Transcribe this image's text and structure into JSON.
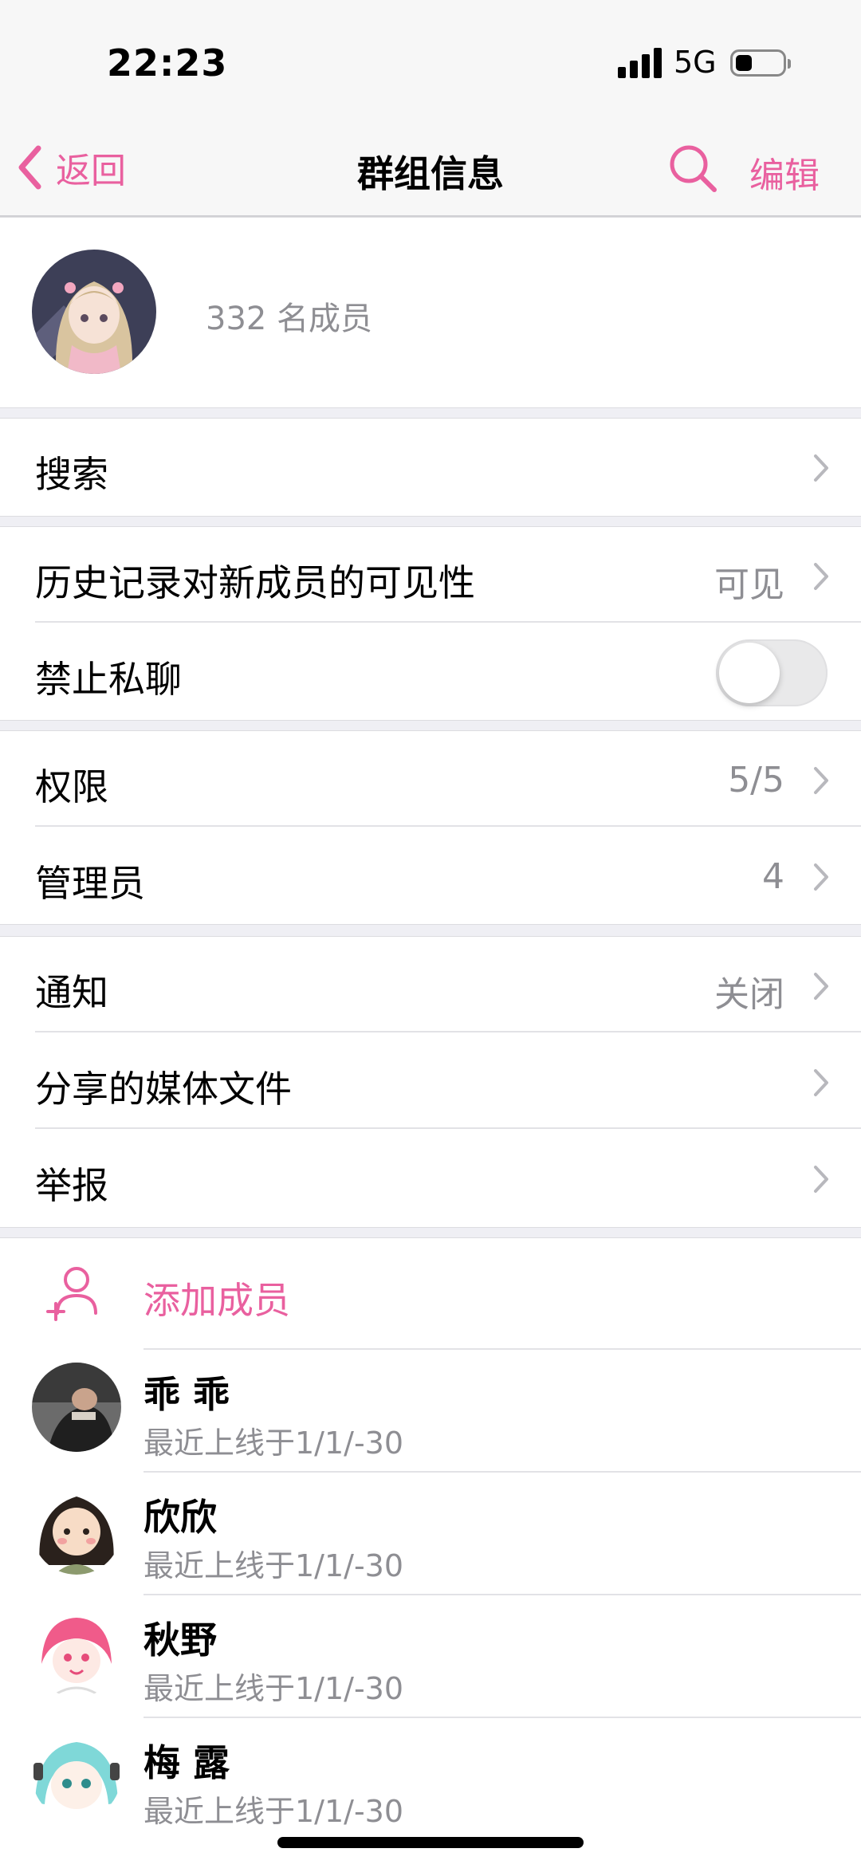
{
  "status_bar": {
    "time": "22:23",
    "network": "5G"
  },
  "nav": {
    "back_label": "返回",
    "title": "群组信息",
    "edit_label": "编辑"
  },
  "group": {
    "members_count": "332 名成员"
  },
  "rows": {
    "search": {
      "label": "搜索"
    },
    "history": {
      "label": "历史记录对新成员的可见性",
      "value": "可见"
    },
    "no_private_chat": {
      "label": "禁止私聊",
      "enabled": false
    },
    "permissions": {
      "label": "权限",
      "value": "5/5"
    },
    "admins": {
      "label": "管理员",
      "value": "4"
    },
    "notifications": {
      "label": "通知",
      "value": "关闭"
    },
    "shared_media": {
      "label": "分享的媒体文件"
    },
    "report": {
      "label": "举报"
    }
  },
  "members": {
    "add_label": "添加成员",
    "list": [
      {
        "name": "乖 乖",
        "status": "最近上线于1/1/-30"
      },
      {
        "name": "欣欣",
        "status": "最近上线于1/1/-30"
      },
      {
        "name": "秋野",
        "status": "最近上线于1/1/-30"
      },
      {
        "name": "梅 露",
        "status": "最近上线于1/1/-30"
      }
    ]
  },
  "colors": {
    "accent": "#e9609f",
    "secondary_text": "#8e8e93",
    "background": "#efeff4"
  }
}
